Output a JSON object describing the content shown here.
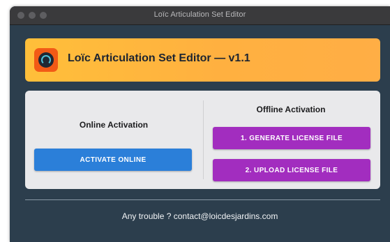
{
  "window": {
    "title": "Loïc Articulation Set Editor"
  },
  "header": {
    "title": "Loïc Articulation Set Editor — v1.1",
    "logo_icon": "speedometer-logo-icon"
  },
  "online": {
    "title": "Online Activation",
    "activate_label": "ACTIVATE ONLINE"
  },
  "offline": {
    "title": "Offline Activation",
    "generate_label": "1. GENERATE LICENSE FILE",
    "upload_label": "2. UPLOAD LICENSE FILE"
  },
  "footer": {
    "text": "Any trouble ? contact@loicdesjardins.com"
  },
  "colors": {
    "window_bg": "#2c3e4d",
    "header_bg": "#ffb93e",
    "activate_button": "#2b7fd9",
    "offline_buttons": "#a22dbf"
  }
}
